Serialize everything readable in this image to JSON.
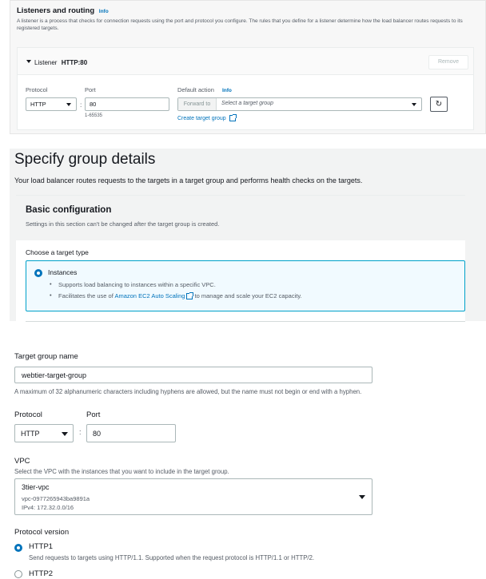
{
  "listeners": {
    "title": "Listeners and routing",
    "info": "Info",
    "description": "A listener is a process that checks for connection requests using the port and protocol you configure. The rules that you define for a listener determine how the load balancer routes requests to its registered targets.",
    "listener_label": "Listener",
    "listener_name": "HTTP:80",
    "remove_label": "Remove",
    "protocol_label": "Protocol",
    "protocol_value": "HTTP",
    "port_label": "Port",
    "port_value": "80",
    "port_hint": "1-65535",
    "default_action_label": "Default action",
    "default_action_info": "Info",
    "forward_to_label": "Forward to",
    "target_group_placeholder": "Select a target group",
    "create_target_group": "Create target group"
  },
  "group_details": {
    "title": "Specify group details",
    "description": "Your load balancer routes requests to the targets in a target group and performs health checks on the targets."
  },
  "basic_config": {
    "title": "Basic configuration",
    "subtitle": "Settings in this section can't be changed after the target group is created.",
    "target_type_label": "Choose a target type",
    "instances_label": "Instances",
    "bullet_1": "Supports load balancing to instances within a specific VPC.",
    "bullet_2_prefix": "Facilitates the use of",
    "bullet_2_link": "Amazon EC2 Auto Scaling",
    "bullet_2_suffix": "to manage and scale your EC2 capacity."
  },
  "target_group": {
    "name_label": "Target group name",
    "name_value": "webtier-target-group",
    "name_hint": "A maximum of 32 alphanumeric characters including hyphens are allowed, but the name must not begin or end with a hyphen.",
    "protocol_label": "Protocol",
    "protocol_value": "HTTP",
    "port_label": "Port",
    "port_value": "80",
    "vpc_label": "VPC",
    "vpc_hint": "Select the VPC with the instances that you want to include in the target group.",
    "vpc_name": "3tier-vpc",
    "vpc_id": "vpc-0977265943ba9891a",
    "vpc_cidr": "IPv4: 172.32.0.0/16",
    "protocol_version_label": "Protocol version",
    "http1_label": "HTTP1",
    "http1_desc": "Send requests to targets using HTTP/1.1. Supported when the request protocol is HTTP/1.1 or HTTP/2.",
    "http2_label": "HTTP2"
  },
  "colors": {
    "accent": "#0073bb",
    "border": "#aab7b8",
    "panel_bg": "#f2f3f3",
    "selected_bg": "#f1faff"
  }
}
